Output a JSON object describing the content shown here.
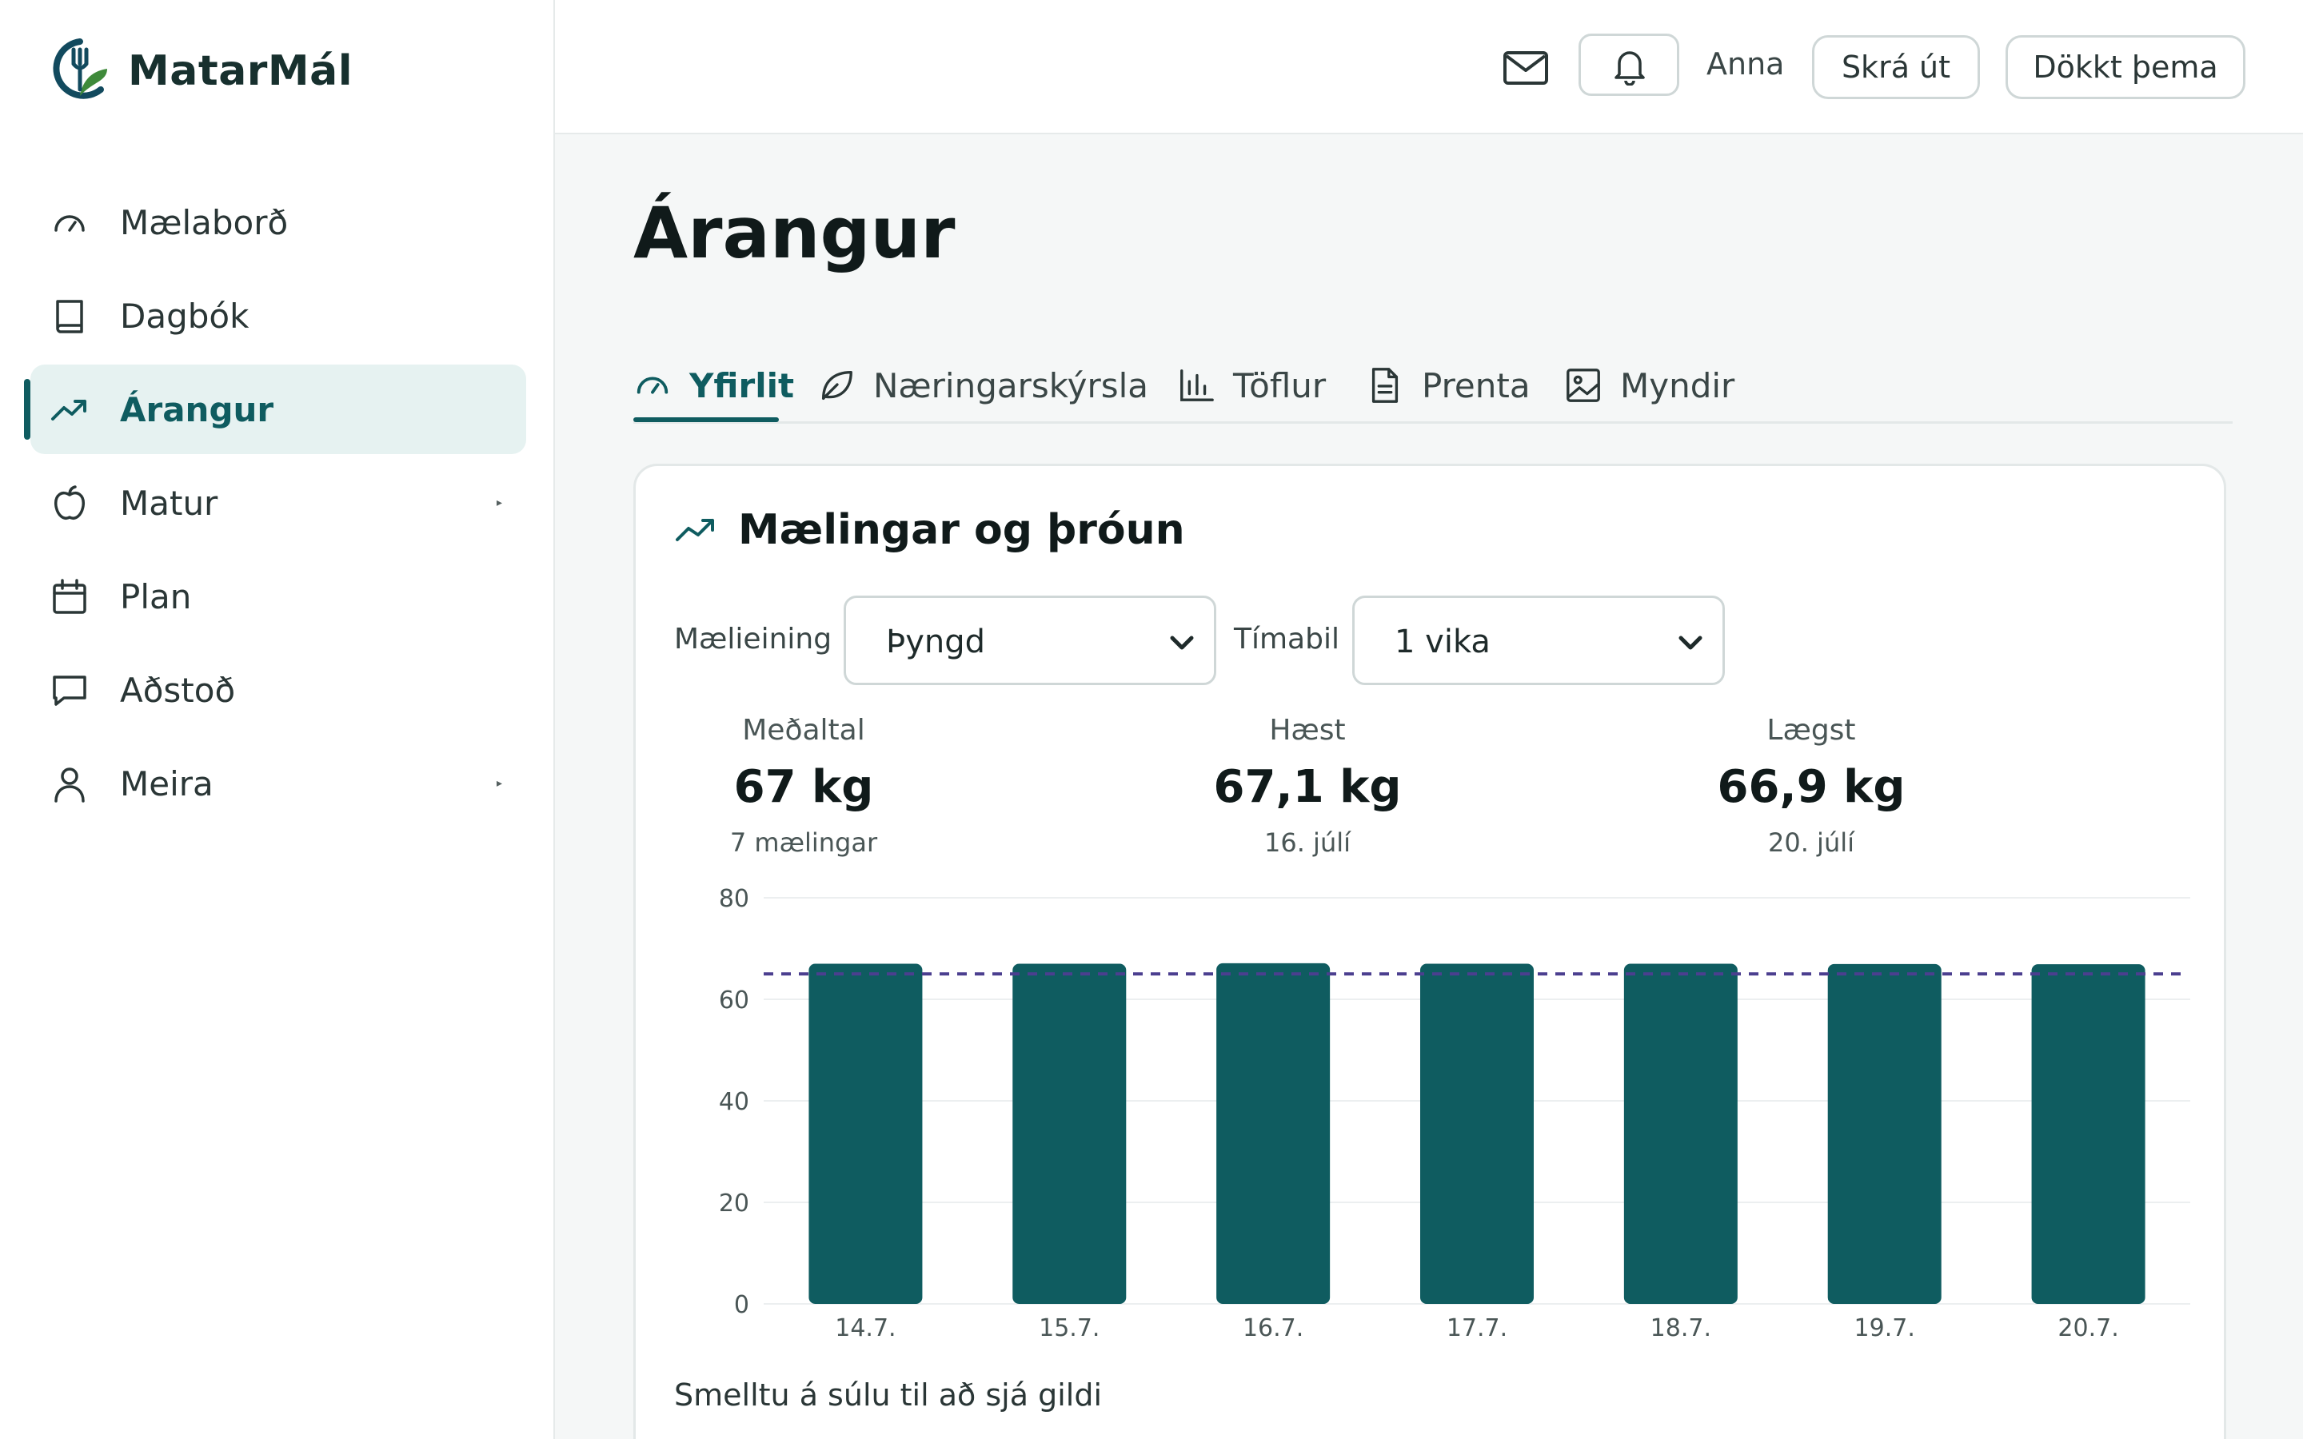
{
  "app": {
    "name": "MatarMál"
  },
  "sidebar": {
    "items": [
      {
        "label": "Mælaborð",
        "icon": "gauge-icon",
        "has_submenu": false
      },
      {
        "label": "Dagbók",
        "icon": "book-icon",
        "has_submenu": false
      },
      {
        "label": "Árangur",
        "icon": "trending-up-icon",
        "active": true,
        "has_submenu": false
      },
      {
        "label": "Matur",
        "icon": "apple-icon",
        "has_submenu": true,
        "caret": "▸"
      },
      {
        "label": "Plan",
        "icon": "calendar-icon",
        "has_submenu": false
      },
      {
        "label": "Aðstoð",
        "icon": "chat-icon",
        "has_submenu": false
      },
      {
        "label": "Meira",
        "icon": "user-icon",
        "has_submenu": true,
        "caret": "▸"
      }
    ]
  },
  "topbar": {
    "user_name": "Anna",
    "logout_label": "Skrá út",
    "theme_label": "Dökkt þema"
  },
  "page": {
    "title": "Árangur"
  },
  "tabs": [
    {
      "label": "Yfirlit",
      "icon": "gauge-icon",
      "active": true
    },
    {
      "label": "Næringarskýrsla",
      "icon": "leaf-icon"
    },
    {
      "label": "Töflur",
      "icon": "bar-chart-icon"
    },
    {
      "label": "Prenta",
      "icon": "document-icon"
    },
    {
      "label": "Myndir",
      "icon": "image-icon"
    }
  ],
  "card": {
    "title": "Mælingar og þróun",
    "measure_label": "Mælieining",
    "measure_value": "Þyngd",
    "period_label": "Tímabil",
    "period_value": "1 vika",
    "hint": "Smelltu á súlu til að sjá gildi"
  },
  "stats": {
    "average": {
      "label": "Meðaltal",
      "value": "67 kg",
      "sub": "7 mælingar"
    },
    "highest": {
      "label": "Hæst",
      "value": "67,1 kg",
      "sub": "16. júlí"
    },
    "lowest": {
      "label": "Lægst",
      "value": "66,9 kg",
      "sub": "20. júlí"
    }
  },
  "colors": {
    "accent": "#0f5c60",
    "bar": "#0f5c60",
    "average_line": "#4b3f8f",
    "active_nav_bg": "#e6f2f1"
  },
  "chart_data": {
    "type": "bar",
    "categories": [
      "14.7.",
      "15.7.",
      "16.7.",
      "17.7.",
      "18.7.",
      "19.7.",
      "20.7."
    ],
    "values": [
      67.0,
      67.0,
      67.1,
      67.0,
      67.0,
      66.95,
      66.9
    ],
    "reference_line": {
      "value": 65,
      "style": "dashed"
    },
    "ylim": [
      0,
      80
    ],
    "yticks": [
      0,
      20,
      40,
      60,
      80
    ],
    "grid": true,
    "legend": "none"
  }
}
